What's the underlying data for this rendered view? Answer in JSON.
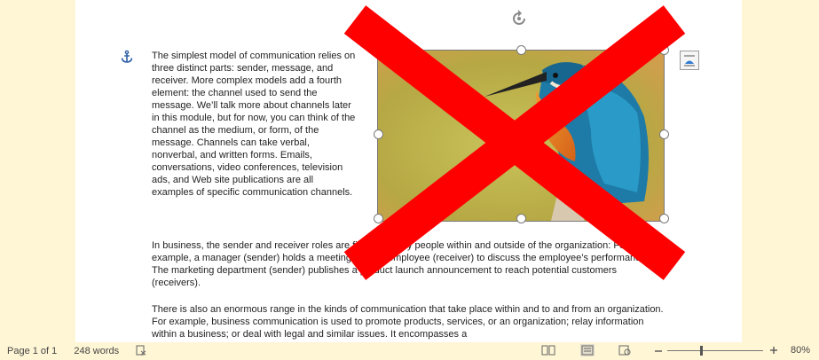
{
  "document": {
    "paragraphs": [
      "The simplest model of communication relies on three distinct parts: sender, message, and receiver. More complex models add a fourth element: the channel used to send the message. We’ll talk more about channels later in this module, but for now, you can think of the channel as the medium, or form, of the message. Channels can take verbal, nonverbal, and written forms. Emails, conversations, video conferences, television ads, and Web site publications are all examples of specific communication channels.",
      "In business, the sender and receiver roles are filled by many people within and outside of the organization: For example, a manager (sender) holds a meeting with an employee (receiver) to discuss the employee’s performance. The marketing department (sender) publishes a product launch announcement to reach potential customers (receivers).",
      "There is also an enormous range in the kinds of communication that take place within and to and from an organization. For example, business communication is used to promote products, services, or an organization; relay information within a business; or deal with legal and similar issues. It encompasses a"
    ],
    "overlay_color": "#ff0000"
  },
  "statusbar": {
    "page": "Page 1 of 1",
    "words": "248 words",
    "zoom": "80%"
  },
  "icons": [
    "anchor-icon",
    "rotate-handle-icon",
    "layout-options-icon",
    "proofing-icon",
    "read-mode-icon",
    "print-layout-icon",
    "web-layout-icon",
    "zoom-out-icon",
    "zoom-in-icon"
  ]
}
